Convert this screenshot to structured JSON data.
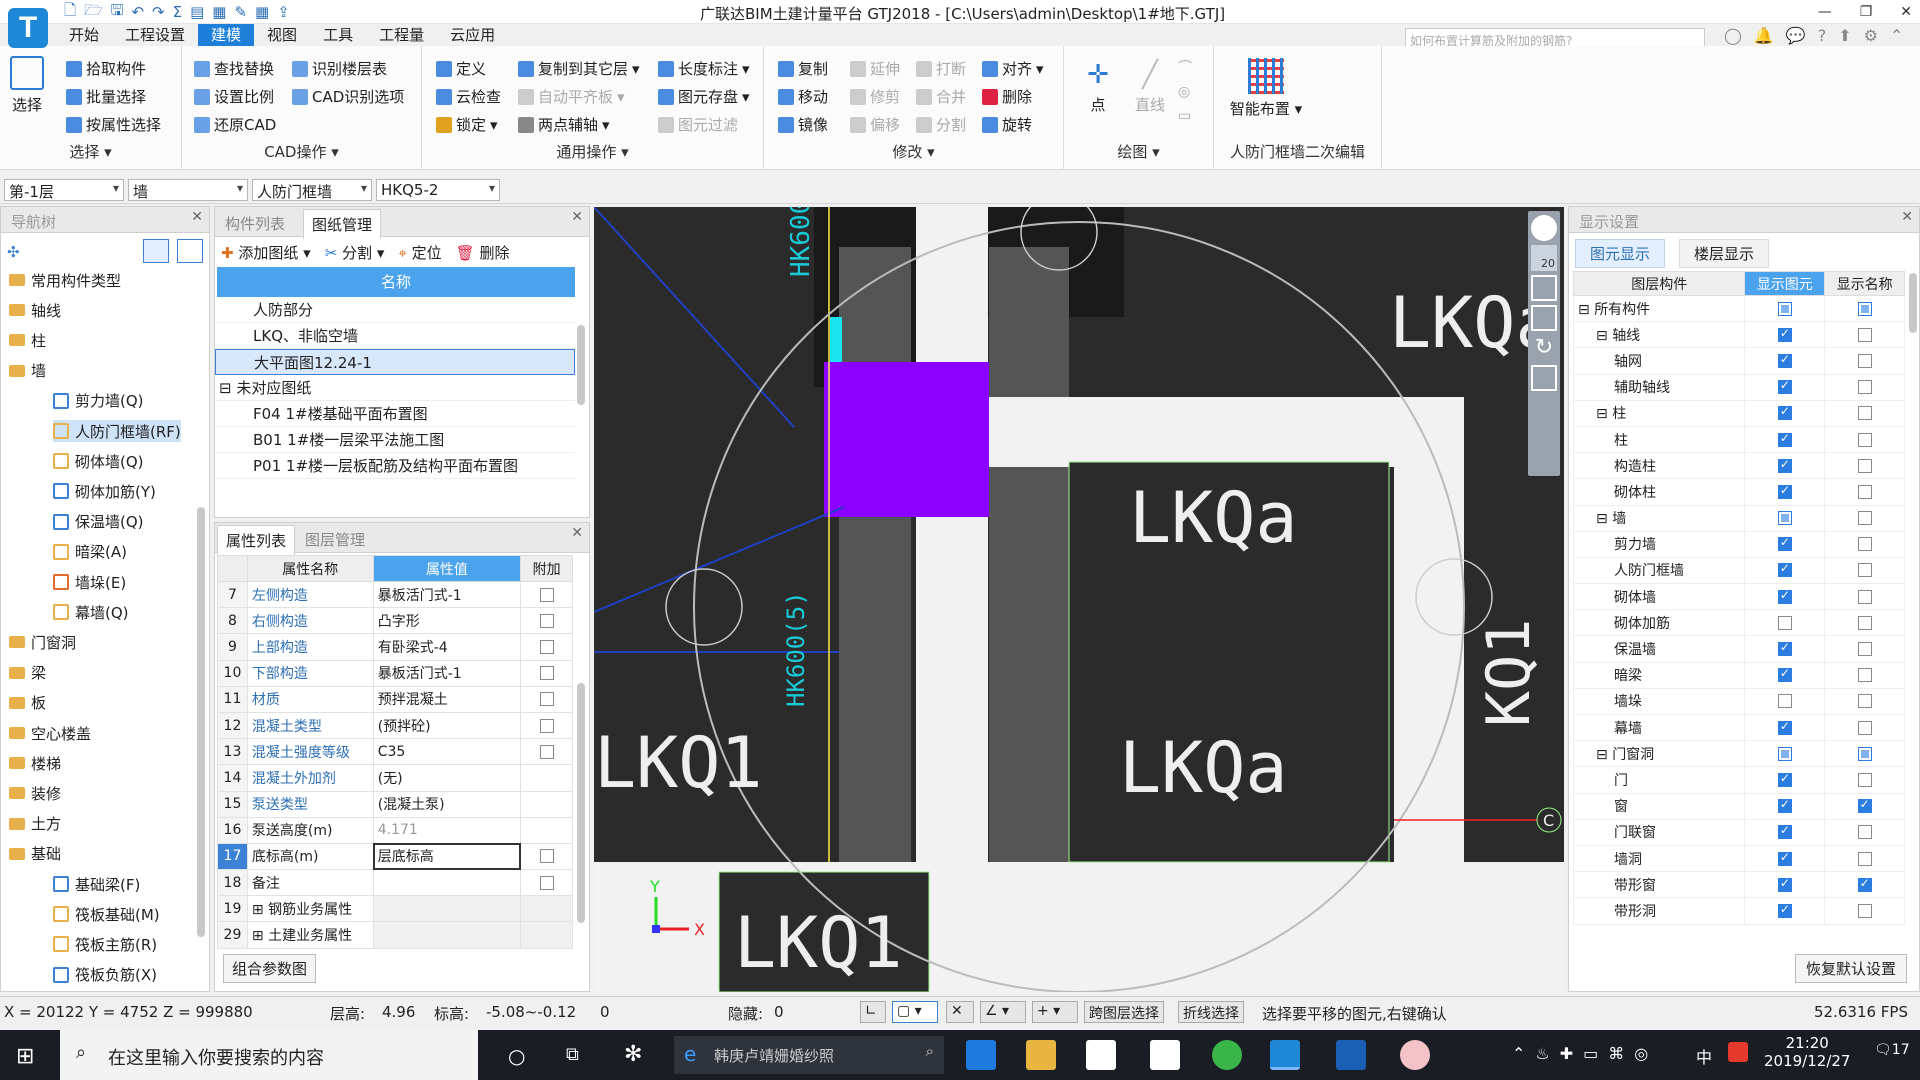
{
  "window": {
    "title": "广联达BIM土建计量平台 GTJ2018 - [C:\\Users\\admin\\Desktop\\1#地下.GTJ]",
    "logo": "T",
    "search_placeholder": "如何布置计算筋及附加的钢筋?",
    "controls": [
      "—",
      "❐",
      "✕"
    ]
  },
  "menu": {
    "tabs": [
      "开始",
      "工程设置",
      "建模",
      "视图",
      "工具",
      "工程量",
      "云应用"
    ],
    "active": "建模"
  },
  "ribbon": {
    "select": {
      "big": "选择",
      "items": [
        "拾取构件",
        "批量选择",
        "按属性选择"
      ],
      "label": "选择"
    },
    "cad": {
      "items": [
        "查找替换",
        "识别楼层表",
        "设置比例",
        "CAD识别选项",
        "还原CAD"
      ],
      "label": "CAD操作"
    },
    "general": {
      "items": [
        "定义",
        "复制到其它层",
        "长度标注",
        "云检查",
        "自动平齐板",
        "图元存盘",
        "锁定",
        "两点辅轴",
        "图元过滤"
      ],
      "label": "通用操作"
    },
    "modify": {
      "items": [
        "复制",
        "延伸",
        "打断",
        "对齐",
        "移动",
        "修剪",
        "合并",
        "删除",
        "镜像",
        "偏移",
        "分割",
        "旋转"
      ],
      "label": "修改"
    },
    "draw": {
      "items": [
        "点",
        "直线"
      ],
      "label": "绘图"
    },
    "smart": {
      "big": "智能布置",
      "label": "人防门框墙二次编辑"
    }
  },
  "selectors": {
    "floor": "第-1层",
    "type": "墙",
    "subtype": "人防门框墙",
    "name": "HKQ5-2"
  },
  "nav": {
    "title": "导航树",
    "items": [
      {
        "label": "常用构件类型",
        "level": 0
      },
      {
        "label": "轴线",
        "level": 0
      },
      {
        "label": "柱",
        "level": 0
      },
      {
        "label": "墙",
        "level": 0
      },
      {
        "label": "剪力墙(Q)",
        "level": 1
      },
      {
        "label": "人防门框墙(RF)",
        "level": 1,
        "selected": true
      },
      {
        "label": "砌体墙(Q)",
        "level": 1
      },
      {
        "label": "砌体加筋(Y)",
        "level": 1
      },
      {
        "label": "保温墙(Q)",
        "level": 1
      },
      {
        "label": "暗梁(A)",
        "level": 1
      },
      {
        "label": "墙垛(E)",
        "level": 1
      },
      {
        "label": "幕墙(Q)",
        "level": 1
      },
      {
        "label": "门窗洞",
        "level": 0
      },
      {
        "label": "梁",
        "level": 0
      },
      {
        "label": "板",
        "level": 0
      },
      {
        "label": "空心楼盖",
        "level": 0
      },
      {
        "label": "楼梯",
        "level": 0
      },
      {
        "label": "装修",
        "level": 0
      },
      {
        "label": "土方",
        "level": 0
      },
      {
        "label": "基础",
        "level": 0
      },
      {
        "label": "基础梁(F)",
        "level": 1
      },
      {
        "label": "筏板基础(M)",
        "level": 1
      },
      {
        "label": "筏板主筋(R)",
        "level": 1
      },
      {
        "label": "筏板负筋(X)",
        "level": 1
      }
    ]
  },
  "drawings": {
    "tabs": [
      "构件列表",
      "图纸管理"
    ],
    "active_tab": "图纸管理",
    "toolbar": [
      "添加图纸",
      "分割",
      "定位",
      "删除"
    ],
    "column": "名称",
    "rows": [
      {
        "label": "人防部分",
        "indent": 1
      },
      {
        "label": "LKQ、非临空墙",
        "indent": 1
      },
      {
        "label": "大平面图12.24-1",
        "indent": 1,
        "selected": true
      },
      {
        "label": "未对应图纸",
        "indent": 0,
        "group": true
      },
      {
        "label": "F04 1#楼基础平面布置图",
        "indent": 1
      },
      {
        "label": "B01 1#楼一层梁平法施工图",
        "indent": 1
      },
      {
        "label": "P01 1#楼一层板配筋及结构平面布置图",
        "indent": 1
      }
    ]
  },
  "properties": {
    "tabs": [
      "属性列表",
      "图层管理"
    ],
    "active_tab": "属性列表",
    "headers": [
      "属性名称",
      "属性值",
      "附加"
    ],
    "rows": [
      {
        "no": "7",
        "name": "左侧构造",
        "value": "暴板活门式-1",
        "link": true,
        "check": true
      },
      {
        "no": "8",
        "name": "右侧构造",
        "value": "凸字形",
        "link": true,
        "check": true
      },
      {
        "no": "9",
        "name": "上部构造",
        "value": "有卧梁式-4",
        "link": true,
        "check": true
      },
      {
        "no": "10",
        "name": "下部构造",
        "value": "暴板活门式-1",
        "link": true,
        "check": true
      },
      {
        "no": "11",
        "name": "材质",
        "value": "预拌混凝土",
        "link": true,
        "check": true
      },
      {
        "no": "12",
        "name": "混凝土类型",
        "value": "(预拌砼)",
        "link": true,
        "check": true
      },
      {
        "no": "13",
        "name": "混凝土强度等级",
        "value": "C35",
        "link": true,
        "check": true
      },
      {
        "no": "14",
        "name": "混凝土外加剂",
        "value": "(无)",
        "link": true,
        "check": false
      },
      {
        "no": "15",
        "name": "泵送类型",
        "value": "(混凝土泵)",
        "link": true,
        "check": false
      },
      {
        "no": "16",
        "name": "泵送高度(m)",
        "value": "4.171",
        "link": false,
        "check": false,
        "grey": true
      },
      {
        "no": "17",
        "name": "底标高(m)",
        "value": "层底标高",
        "link": false,
        "check": true,
        "selected": true
      },
      {
        "no": "18",
        "name": "备注",
        "value": "",
        "link": false,
        "check": true
      },
      {
        "no": "19",
        "name": "钢筋业务属性",
        "value": "",
        "expand": true
      },
      {
        "no": "29",
        "name": "土建业务属性",
        "value": "",
        "expand": true
      }
    ],
    "footer_button": "组合参数图"
  },
  "canvas": {
    "labels": [
      "HK600",
      "HK600(5)",
      "LKQa",
      "LKQa",
      "LKQa",
      "LKQ1",
      "LKQ1",
      "LKQa",
      "KQ1",
      "C"
    ],
    "axis_x": "X",
    "axis_y": "Y",
    "view_badge": "20"
  },
  "display": {
    "title": "显示设置",
    "tabs": [
      "图元显示",
      "楼层显示"
    ],
    "active_tab": "图元显示",
    "headers": [
      "图层构件",
      "显示图元",
      "显示名称"
    ],
    "rows": [
      {
        "label": "所有构件",
        "level": 0,
        "expand": true,
        "show": "part",
        "name": "part"
      },
      {
        "label": "轴线",
        "level": 1,
        "expand": true,
        "show": "on",
        "name": "off"
      },
      {
        "label": "轴网",
        "level": 2,
        "show": "on",
        "name": "off"
      },
      {
        "label": "辅助轴线",
        "level": 2,
        "show": "on",
        "name": "off"
      },
      {
        "label": "柱",
        "level": 1,
        "expand": true,
        "show": "on",
        "name": "off"
      },
      {
        "label": "柱",
        "level": 2,
        "show": "on",
        "name": "off"
      },
      {
        "label": "构造柱",
        "level": 2,
        "show": "on",
        "name": "off"
      },
      {
        "label": "砌体柱",
        "level": 2,
        "show": "on",
        "name": "off"
      },
      {
        "label": "墙",
        "level": 1,
        "expand": true,
        "show": "part",
        "name": "off"
      },
      {
        "label": "剪力墙",
        "level": 2,
        "show": "on",
        "name": "off"
      },
      {
        "label": "人防门框墙",
        "level": 2,
        "show": "on",
        "name": "off"
      },
      {
        "label": "砌体墙",
        "level": 2,
        "show": "on",
        "name": "off"
      },
      {
        "label": "砌体加筋",
        "level": 2,
        "show": "off",
        "name": "off"
      },
      {
        "label": "保温墙",
        "level": 2,
        "show": "on",
        "name": "off"
      },
      {
        "label": "暗梁",
        "level": 2,
        "show": "on",
        "name": "off"
      },
      {
        "label": "墙垛",
        "level": 2,
        "show": "off",
        "name": "off"
      },
      {
        "label": "幕墙",
        "level": 2,
        "show": "on",
        "name": "off"
      },
      {
        "label": "门窗洞",
        "level": 1,
        "expand": true,
        "show": "part",
        "name": "part"
      },
      {
        "label": "门",
        "level": 2,
        "show": "on",
        "name": "off"
      },
      {
        "label": "窗",
        "level": 2,
        "show": "on",
        "name": "on"
      },
      {
        "label": "门联窗",
        "level": 2,
        "show": "on",
        "name": "off"
      },
      {
        "label": "墙洞",
        "level": 2,
        "show": "on",
        "name": "off"
      },
      {
        "label": "带形窗",
        "level": 2,
        "show": "on",
        "name": "on"
      },
      {
        "label": "带形洞",
        "level": 2,
        "show": "on",
        "name": "off"
      }
    ],
    "reset_button": "恢复默认设置"
  },
  "status": {
    "coords": "X = 20122 Y = 4752 Z = 999880",
    "floor_height_label": "层高:",
    "floor_height": "4.96",
    "elevation_label": "标高:",
    "elevation": "-5.08~-0.12",
    "zero": "0",
    "hidden_label": "隐藏:",
    "hidden": "0",
    "btn_cross_layer": "跨图层选择",
    "btn_polyline": "折线选择",
    "hint": "选择要平移的图元,右键确认",
    "fps": "52.6316 FPS"
  },
  "taskbar": {
    "search": "在这里输入你要搜索的内容",
    "browser_tab": "韩庚卢靖姗婚纱照",
    "time": "21:20",
    "date": "2019/12/27",
    "ime": "中",
    "notif": "17"
  },
  "colors": {
    "accent": "#1e7fd8",
    "canvas_bg": "#2b2b2b",
    "purple_wall": "#8b00ff",
    "cyan_text": "#19c9d6"
  }
}
